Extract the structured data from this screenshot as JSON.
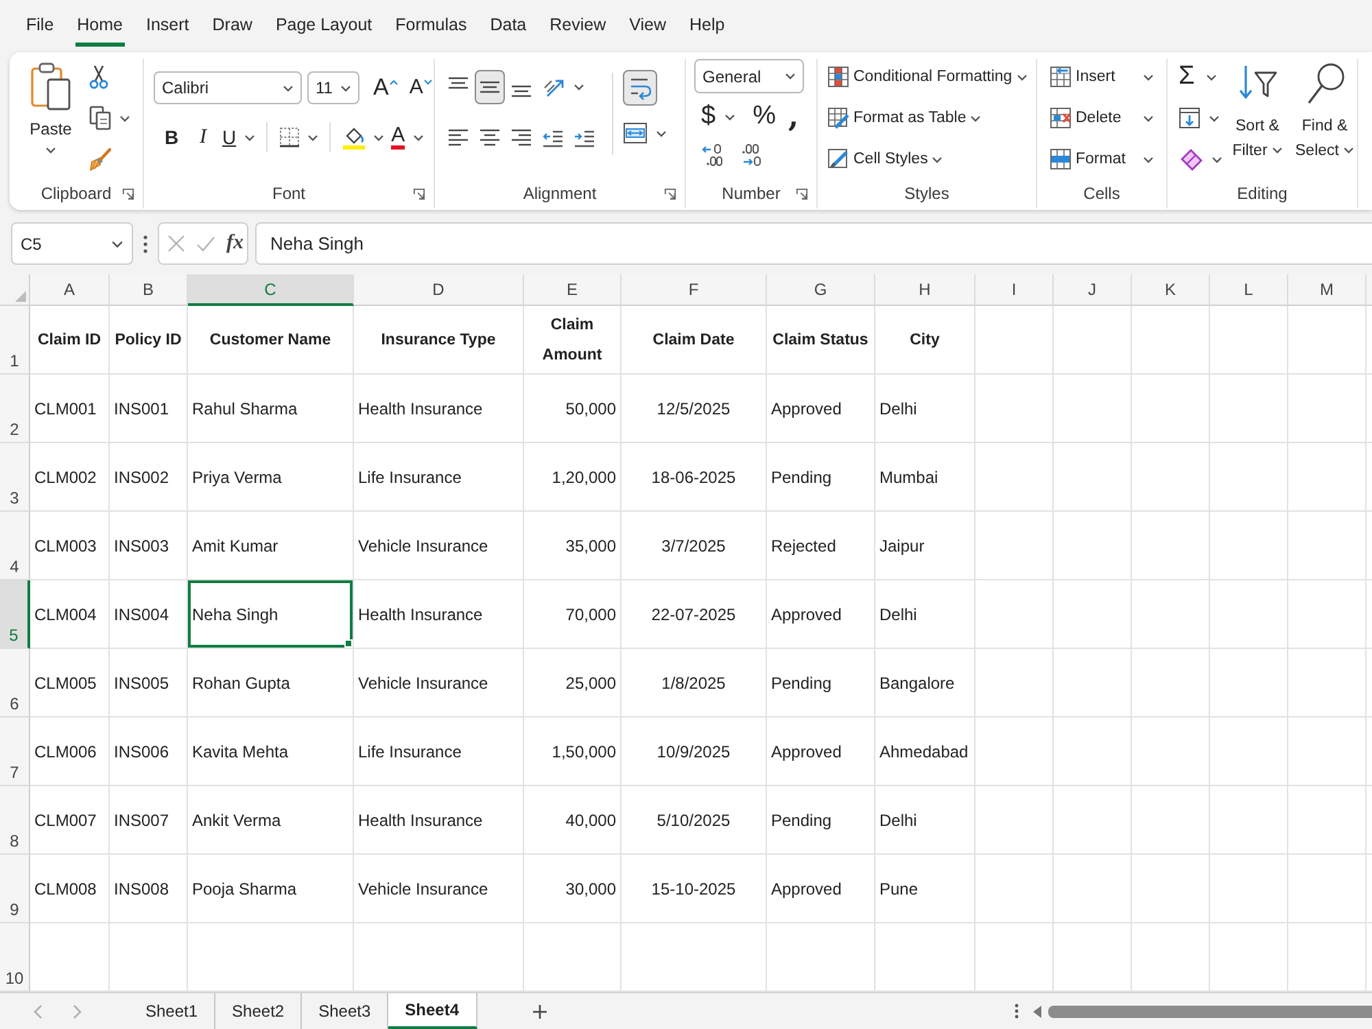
{
  "menu_tabs": [
    {
      "label": "File",
      "selected": false
    },
    {
      "label": "Home",
      "selected": true
    },
    {
      "label": "Insert",
      "selected": false
    },
    {
      "label": "Draw",
      "selected": false
    },
    {
      "label": "Page Layout",
      "selected": false
    },
    {
      "label": "Formulas",
      "selected": false
    },
    {
      "label": "Data",
      "selected": false
    },
    {
      "label": "Review",
      "selected": false
    },
    {
      "label": "View",
      "selected": false
    },
    {
      "label": "Help",
      "selected": false
    }
  ],
  "ribbon": {
    "clipboard": {
      "label": "Clipboard",
      "launcher": true,
      "paste": "Paste"
    },
    "font": {
      "label": "Font",
      "launcher": true,
      "name": "Calibri",
      "size": "11",
      "grow": "A",
      "shrink": "A",
      "bold": "B",
      "italic": "I",
      "underline": "U",
      "font_color": "A"
    },
    "alignment": {
      "label": "Alignment",
      "launcher": true,
      "align_buttons": [
        {
          "kind": "top",
          "pressed": false
        },
        {
          "kind": "middle",
          "pressed": true
        },
        {
          "kind": "bottom",
          "pressed": false
        },
        {
          "kind": "left",
          "pressed": false
        },
        {
          "kind": "center",
          "pressed": false
        },
        {
          "kind": "right",
          "pressed": false
        }
      ],
      "wrap_text": {
        "pressed": true
      }
    },
    "number": {
      "label": "Number",
      "launcher": true,
      "format": "General",
      "currency": "$",
      "percent": "%",
      "comma": ","
    },
    "styles": {
      "label": "Styles",
      "launcher": false,
      "items": [
        {
          "kind": "conditional",
          "label": "Conditional Formatting"
        },
        {
          "kind": "table",
          "label": "Format as Table"
        },
        {
          "kind": "cell_styles",
          "label": "Cell Styles"
        }
      ]
    },
    "cells": {
      "label": "Cells",
      "launcher": false,
      "items": [
        {
          "kind": "insert",
          "label": "Insert"
        },
        {
          "kind": "delete",
          "label": "Delete"
        },
        {
          "kind": "format",
          "label": "Format"
        }
      ]
    },
    "editing": {
      "label": "Editing",
      "launcher": false,
      "autosum": "Σ",
      "sort_filter": "Sort & Filter",
      "find_select": "Find & Select"
    }
  },
  "formula_bar": {
    "name_box": "C5",
    "function_label": "fx",
    "value": "Neha Singh"
  },
  "sheet": {
    "columns": [
      {
        "label": "A",
        "kind": "text",
        "selected": false
      },
      {
        "label": "B",
        "kind": "text",
        "selected": false
      },
      {
        "label": "C",
        "kind": "text",
        "selected": true
      },
      {
        "label": "D",
        "kind": "text",
        "selected": false
      },
      {
        "label": "E",
        "kind": "number",
        "selected": false
      },
      {
        "label": "F",
        "kind": "date",
        "selected": false
      },
      {
        "label": "G",
        "kind": "text",
        "selected": false
      },
      {
        "label": "H",
        "kind": "text",
        "selected": false
      }
    ],
    "blank_columns": [
      {
        "label": "I",
        "selected": false
      },
      {
        "label": "J",
        "selected": false
      },
      {
        "label": "K",
        "selected": false
      },
      {
        "label": "L",
        "selected": false
      },
      {
        "label": "M",
        "selected": false
      }
    ],
    "header_row": {
      "number": "1",
      "selected": false,
      "cells": [
        "Claim ID",
        "Policy ID",
        "Customer Name",
        "Insurance Type",
        "Claim Amount",
        "Claim Date",
        "Claim Status",
        "City"
      ]
    },
    "rows": [
      {
        "number": "2",
        "selected": false,
        "cells": [
          "CLM001",
          "INS001",
          "Rahul Sharma",
          "Health Insurance",
          "50,000",
          "12/5/2025",
          "Approved",
          "Delhi"
        ]
      },
      {
        "number": "3",
        "selected": false,
        "cells": [
          "CLM002",
          "INS002",
          "Priya Verma",
          "Life Insurance",
          "1,20,000",
          "18-06-2025",
          "Pending",
          "Mumbai"
        ]
      },
      {
        "number": "4",
        "selected": false,
        "cells": [
          "CLM003",
          "INS003",
          "Amit Kumar",
          "Vehicle Insurance",
          "35,000",
          "3/7/2025",
          "Rejected",
          "Jaipur"
        ]
      },
      {
        "number": "5",
        "selected": true,
        "cells": [
          "CLM004",
          "INS004",
          "Neha Singh",
          "Health Insurance",
          "70,000",
          "22-07-2025",
          "Approved",
          "Delhi"
        ]
      },
      {
        "number": "6",
        "selected": false,
        "cells": [
          "CLM005",
          "INS005",
          "Rohan Gupta",
          "Vehicle Insurance",
          "25,000",
          "1/8/2025",
          "Pending",
          "Bangalore"
        ]
      },
      {
        "number": "7",
        "selected": false,
        "cells": [
          "CLM006",
          "INS006",
          "Kavita Mehta",
          "Life Insurance",
          "1,50,000",
          "10/9/2025",
          "Approved",
          "Ahmedabad"
        ]
      },
      {
        "number": "8",
        "selected": false,
        "cells": [
          "CLM007",
          "INS007",
          "Ankit Verma",
          "Health Insurance",
          "40,000",
          "5/10/2025",
          "Pending",
          "Delhi"
        ]
      },
      {
        "number": "9",
        "selected": false,
        "cells": [
          "CLM008",
          "INS008",
          "Pooja Sharma",
          "Vehicle Insurance",
          "30,000",
          "15-10-2025",
          "Approved",
          "Pune"
        ]
      },
      {
        "number": "10",
        "selected": false
      }
    ]
  },
  "sheet_tabs": [
    {
      "label": "Sheet1",
      "selected": false
    },
    {
      "label": "Sheet2",
      "selected": false
    },
    {
      "label": "Sheet3",
      "selected": false
    },
    {
      "label": "Sheet4",
      "selected": true
    }
  ]
}
